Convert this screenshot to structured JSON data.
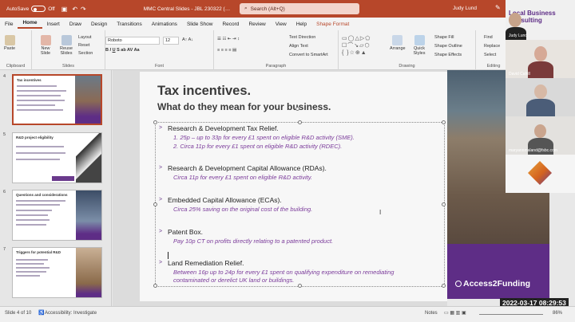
{
  "titlebar": {
    "autosave": "AutoSave",
    "autosave_state": "Off",
    "doc_title": "MMC Central Slides - JBL 230322 (…",
    "search": "Search (Alt+Q)",
    "user": "Judy Lund"
  },
  "menu": [
    "File",
    "Home",
    "Insert",
    "Draw",
    "Design",
    "Transitions",
    "Animations",
    "Slide Show",
    "Record",
    "Review",
    "View",
    "Help",
    "Shape Format"
  ],
  "ribbon": {
    "clipboard": {
      "paste": "Paste",
      "label": "Clipboard"
    },
    "slides": {
      "new_slide": "New Slide",
      "reuse_slides": "Reuse Slides",
      "layout": "Layout",
      "reset": "Reset",
      "section": "Section",
      "label": "Slides"
    },
    "font": {
      "name": "Roboto",
      "size": "12",
      "label": "Font"
    },
    "paragraph": {
      "text_direction": "Text Direction",
      "align_text": "Align Text",
      "smartart": "Convert to SmartArt",
      "label": "Paragraph"
    },
    "drawing": {
      "arrange": "Arrange",
      "quick_styles": "Quick Styles",
      "shape_fill": "Shape Fill",
      "shape_outline": "Shape Outline",
      "shape_effects": "Shape Effects",
      "label": "Drawing"
    },
    "editing": {
      "find": "Find",
      "replace": "Replace",
      "select": "Select",
      "label": "Editing"
    }
  },
  "thumbnails": [
    {
      "num": "4",
      "title": "Tax incentives"
    },
    {
      "num": "5",
      "title": "R&D project eligibility"
    },
    {
      "num": "6",
      "title": "Questions and considerations"
    },
    {
      "num": "7",
      "title": "Triggers for potential R&D"
    }
  ],
  "slide": {
    "title": "Tax incentives.",
    "subtitle": "What do they mean for your business.",
    "items": [
      {
        "head": "Research & Development Tax Relief.",
        "subs": [
          "1.  25p – up to 33p for every £1 spent on eligible R&D activity (SME).",
          "2.  Circa 11p for every £1 spent on eligible R&D activity (RDEC)."
        ]
      },
      {
        "head": "Research & Development Capital Allowance (RDAs).",
        "subs": [
          "Circa 11p for every £1 spent on eligible R&D activity."
        ]
      },
      {
        "head": "Embedded Capital Allowance (ECAs).",
        "subs": [
          "Circa 25% saving on the original cost of the building."
        ]
      },
      {
        "head": "Patent Box.",
        "subs": [
          "Pay 10p CT on profits directly relating to a patented product."
        ]
      },
      {
        "head": "Land Remediation Relief.",
        "subs": [
          "Between 16p up to 24p for every £1 spent on qualifying expenditure on remediating",
          "contaminated or derelict UK land or buildings."
        ]
      }
    ],
    "brand": "Access2Funding"
  },
  "participants": [
    {
      "name": "Judy Lund"
    },
    {
      "name": "David Cahill"
    },
    {
      "name": ""
    },
    {
      "name": "maryannmaland@fsbc.com"
    }
  ],
  "webcam_banner": "Local Business Consulting",
  "timestamp": "2022-03-17  08:29:53",
  "status": {
    "slide": "Slide 4 of 10",
    "accessibility": "Accessibility: Investigate",
    "notes": "Notes",
    "zoom": "86%"
  },
  "colors": {
    "accent": "#b7472a",
    "purple": "#6a3a8c"
  }
}
